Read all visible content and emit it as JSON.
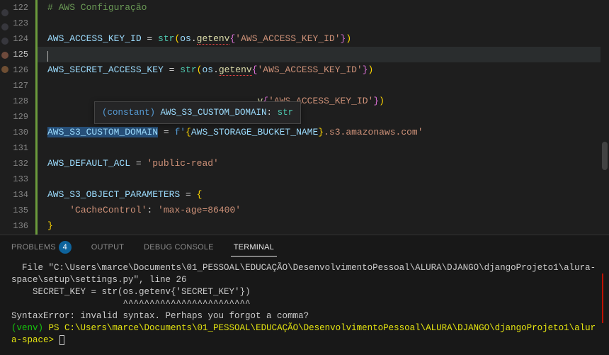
{
  "gutter": {
    "start": 122,
    "end": 136,
    "active": 125
  },
  "code": {
    "l122_comment": "# AWS Configuração",
    "l124_var": "AWS_ACCESS_KEY_ID",
    "l124_eq": " = ",
    "l124_call1": "str",
    "l124_os": "os",
    "l124_getenv": "getenv",
    "l124_str": "'AWS_ACCESS_KEY_ID'",
    "l126_var": "AWS_SECRET_ACCESS_KEY",
    "l126_str": "'AWS_ACCESS_KEY_ID'",
    "l128_frag_v": "v",
    "l128_str": "'AWS_ACCESS_KEY_ID'",
    "l130_var": "AWS_S3_CUSTOM_DOMAIN",
    "l130_f": "f'",
    "l130_inner": "AWS_STORAGE_BUCKET_NAME",
    "l130_tail": ".s3.amazonaws.com'",
    "l132_var": "AWS_DEFAULT_ACL",
    "l132_str": "'public-read'",
    "l134_var": "AWS_S3_OBJECT_PARAMETERS",
    "l135_key": "'CacheControl'",
    "l135_val": "'max-age=86400'"
  },
  "tooltip": {
    "kind": "(constant) ",
    "name": "AWS_S3_CUSTOM_DOMAIN",
    "colon": ": ",
    "type": "str"
  },
  "panel": {
    "tabs": {
      "problems": "PROBLEMS",
      "problems_badge": "4",
      "output": "OUTPUT",
      "debug": "DEBUG CONSOLE",
      "terminal": "TERMINAL"
    },
    "terminal": {
      "l1": "  File \"C:\\Users\\marce\\Documents\\01_PESSOAL\\EDUCAÇÃO\\DesenvolvimentoPessoal\\ALURA\\DJANGO\\djangoProjeto1\\alura-space\\setup\\settings.py\", line 26",
      "l2": "    SECRET_KEY = str(os.getenv{'SECRET_KEY'})",
      "l3": "                     ^^^^^^^^^^^^^^^^^^^^^^^^",
      "l4": "SyntaxError: invalid syntax. Perhaps you forgot a comma?",
      "l5a": "(venv) ",
      "l5b": "PS C:\\Users\\marce\\Documents\\01_PESSOAL\\EDUCAÇÃO\\DesenvolvimentoPessoal\\ALURA\\DJANGO\\djangoProjeto1\\alura-space> "
    }
  }
}
